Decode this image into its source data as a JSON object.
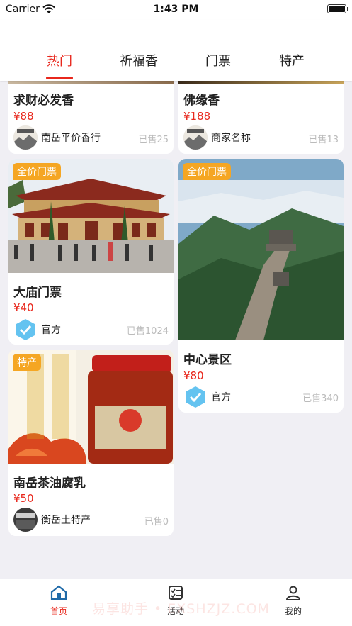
{
  "status_bar": {
    "carrier": "Carrier",
    "time": "1:43 PM"
  },
  "tabs": [
    {
      "label": "热门",
      "active": true
    },
    {
      "label": "祈福香",
      "active": false
    },
    {
      "label": "门票",
      "active": false
    },
    {
      "label": "特产",
      "active": false
    }
  ],
  "products": [
    {
      "title": "求财必发香",
      "price": "¥88",
      "seller": "南岳平价香行",
      "sold": "已售25"
    },
    {
      "title": "佛缘香",
      "price": "¥188",
      "seller": "商家名称",
      "sold": "已售13"
    },
    {
      "badge": "全价门票",
      "title": "大庙门票",
      "price": "¥40",
      "seller": "官方",
      "sold": "已售1024"
    },
    {
      "badge": "全价门票",
      "title": "中心景区",
      "price": "¥80",
      "seller": "官方",
      "sold": "已售340"
    },
    {
      "badge": "特产",
      "title": "南岳茶油腐乳",
      "price": "¥50",
      "seller": "衡岳土特产",
      "sold": "已售0"
    }
  ],
  "bottom_nav": [
    {
      "label": "首页",
      "icon": "home-icon",
      "active": true
    },
    {
      "label": "活动",
      "icon": "checklist-icon",
      "active": false
    },
    {
      "label": "我的",
      "icon": "person-icon",
      "active": false
    }
  ],
  "watermark": "易享助手 • EXSHZJZ.COM",
  "colors": {
    "accent": "#e8271c",
    "badge": "#f5a623",
    "background": "#f0eff4"
  }
}
